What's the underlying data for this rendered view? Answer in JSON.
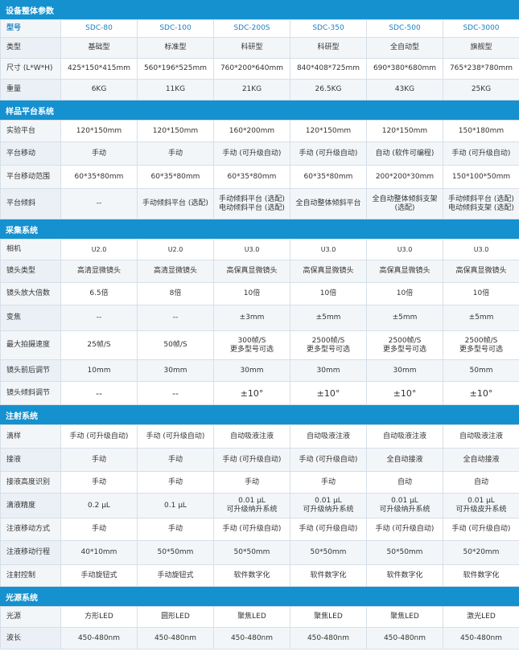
{
  "sections": [
    {
      "title": "设备整体参数",
      "rows": [
        {
          "label": "型号",
          "cells": [
            "SDC-80",
            "SDC-100",
            "SDC-200S",
            "SDC-350",
            "SDC-500",
            "SDC-3000"
          ],
          "h": 22,
          "cls": "model"
        },
        {
          "label": "类型",
          "cells": [
            "基础型",
            "标准型",
            "科研型",
            "科研型",
            "全自动型",
            "旗舰型"
          ],
          "h": 26
        },
        {
          "label": "尺寸 (L*W*H)",
          "cells": [
            "425*150*415mm",
            "560*196*525mm",
            "760*200*640mm",
            "840*408*725mm",
            "690*380*680mm",
            "765*238*780mm"
          ],
          "h": 26
        },
        {
          "label": "重量",
          "cells": [
            "6KG",
            "11KG",
            "21KG",
            "26.5KG",
            "43KG",
            "25KG"
          ],
          "h": 26
        }
      ]
    },
    {
      "title": "样品平台系统",
      "rows": [
        {
          "label": "实验平台",
          "cells": [
            "120*150mm",
            "120*150mm",
            "160*200mm",
            "120*150mm",
            "120*150mm",
            "150*180mm"
          ],
          "h": 27
        },
        {
          "label": "平台移动",
          "cells": [
            "手动",
            "手动",
            "手动 (可升级自动)",
            "手动 (可升级自动)",
            "自动 (软件可编程)",
            "手动 (可升级自动)"
          ],
          "h": 29
        },
        {
          "label": "平台移动范围",
          "cells": [
            "60*35*80mm",
            "60*35*80mm",
            "60*35*80mm",
            "60*35*80mm",
            "200*200*30mm",
            "150*100*50mm"
          ],
          "h": 29
        },
        {
          "label": "平台倾斜",
          "cells": [
            "--",
            "手动倾斜平台 (选配)",
            "手动倾斜平台 (选配)\n电动倾斜平台 (选配)",
            "全自动整体倾斜平台",
            "全自动整体倾斜支架\n(选配)",
            "手动倾斜平台 (选配)\n电动倾斜支架 (选配)"
          ],
          "h": 38
        }
      ]
    },
    {
      "title": "采集系统",
      "rows": [
        {
          "label": "相机",
          "cells": [
            "U2.0",
            "U2.0",
            "U3.0",
            "U3.0",
            "U3.0",
            "U3.0"
          ],
          "h": 26,
          "cellcls": "small"
        },
        {
          "label": "镜头类型",
          "cells": [
            "高清显微镜头",
            "高清显微镜头",
            "高保真显微镜头",
            "高保真显微镜头",
            "高保真显微镜头",
            "高保真显微镜头"
          ],
          "h": 28
        },
        {
          "label": "镜头放大倍数",
          "cells": [
            "6.5倍",
            "8倍",
            "10倍",
            "10倍",
            "10倍",
            "10倍"
          ],
          "h": 28
        },
        {
          "label": "变焦",
          "cells": [
            "--",
            "--",
            "±3mm",
            "±5mm",
            "±5mm",
            "±5mm"
          ],
          "h": 32
        },
        {
          "label": "最大拍摄速度",
          "cells": [
            "25帧/S",
            "50帧/S",
            "300帧/S\n更多型号可选",
            "2500帧/S\n更多型号可选",
            "2500帧/S\n更多型号可选",
            "2500帧/S\n更多型号可选"
          ],
          "h": 36
        },
        {
          "label": "镜头前后调节",
          "cells": [
            "10mm",
            "30mm",
            "30mm",
            "30mm",
            "30mm",
            "50mm"
          ],
          "h": 27
        },
        {
          "label": "镜头倾斜调节",
          "cells": [
            "--",
            "--",
            "±10°",
            "±10°",
            "±10°",
            "±10°"
          ],
          "h": 29,
          "cellcls": "big"
        }
      ]
    },
    {
      "title": "注射系统",
      "rows": [
        {
          "label": "滴样",
          "cells": [
            "手动 (可升级自动)",
            "手动 (可升级自动)",
            "自动吸液注液",
            "自动吸液注液",
            "自动吸液注液",
            "自动吸液注液"
          ],
          "h": 29
        },
        {
          "label": "接液",
          "cells": [
            "手动",
            "手动",
            "手动 (可升级自动)",
            "手动 (可升级自动)",
            "全自动接液",
            "全自动接液"
          ],
          "h": 29
        },
        {
          "label": "接液高度识别",
          "cells": [
            "手动",
            "手动",
            "手动",
            "手动",
            "自动",
            "自动"
          ],
          "h": 27
        },
        {
          "label": "滴液精度",
          "cells": [
            "0.2 μL",
            "0.1 μL",
            "0.01 μL\n可升级纳升系统",
            "0.01 μL\n可升级纳升系统",
            "0.01 μL\n可升级纳升系统",
            "0.01 μL\n可升级皮升系统"
          ],
          "h": 31
        },
        {
          "label": "注液移动方式",
          "cells": [
            "手动",
            "手动",
            "手动 (可升级自动)",
            "手动 (可升级自动)",
            "手动 (可升级自动)",
            "手动 (可升级自动)"
          ],
          "h": 28
        },
        {
          "label": "注液移动行程",
          "cells": [
            "40*10mm",
            "50*50mm",
            "50*50mm",
            "50*50mm",
            "50*50mm",
            "50*20mm"
          ],
          "h": 30
        },
        {
          "label": "注射控制",
          "cells": [
            "手动旋钮式",
            "手动旋钮式",
            "软件数字化",
            "软件数字化",
            "软件数字化",
            "软件数字化"
          ],
          "h": 27
        }
      ]
    },
    {
      "title": "光源系统",
      "rows": [
        {
          "label": "光源",
          "cells": [
            "方形LED",
            "圆形LED",
            "聚焦LED",
            "聚焦LED",
            "聚焦LED",
            "激光LED"
          ],
          "h": 26
        },
        {
          "label": "波长",
          "cells": [
            "450-480nm",
            "450-480nm",
            "450-480nm",
            "450-480nm",
            "450-480nm",
            "450-480nm"
          ],
          "h": 27
        }
      ]
    }
  ]
}
